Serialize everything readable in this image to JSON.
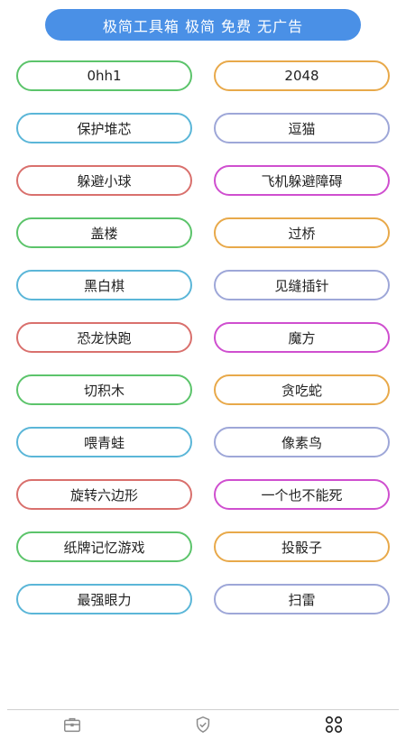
{
  "banner": {
    "text": "极简工具箱 极简 免费 无广告"
  },
  "games": [
    {
      "label": "0hh1",
      "color": "#5cc46b"
    },
    {
      "label": "2048",
      "color": "#e8a94a"
    },
    {
      "label": "保护堆芯",
      "color": "#5bb6d8"
    },
    {
      "label": "逗猫",
      "color": "#9ea7d8"
    },
    {
      "label": "躲避小球",
      "color": "#d9706d"
    },
    {
      "label": "飞机躲避障碍",
      "color": "#cf4fcf"
    },
    {
      "label": "盖楼",
      "color": "#5cc46b"
    },
    {
      "label": "过桥",
      "color": "#e8a94a"
    },
    {
      "label": "黑白棋",
      "color": "#5bb6d8"
    },
    {
      "label": "见缝插针",
      "color": "#9ea7d8"
    },
    {
      "label": "恐龙快跑",
      "color": "#d9706d"
    },
    {
      "label": "魔方",
      "color": "#cf4fcf"
    },
    {
      "label": "切积木",
      "color": "#5cc46b"
    },
    {
      "label": "贪吃蛇",
      "color": "#e8a94a"
    },
    {
      "label": "喂青蛙",
      "color": "#5bb6d8"
    },
    {
      "label": "像素鸟",
      "color": "#9ea7d8"
    },
    {
      "label": "旋转六边形",
      "color": "#d9706d"
    },
    {
      "label": "一个也不能死",
      "color": "#cf4fcf"
    },
    {
      "label": "纸牌记忆游戏",
      "color": "#5cc46b"
    },
    {
      "label": "投骰子",
      "color": "#e8a94a"
    },
    {
      "label": "最强眼力",
      "color": "#5bb6d8"
    },
    {
      "label": "扫雷",
      "color": "#9ea7d8"
    }
  ],
  "bottom_nav": [
    {
      "icon": "toolbox-icon",
      "color": "#8a8a8a"
    },
    {
      "icon": "shield-check-icon",
      "color": "#8a8a8a"
    },
    {
      "icon": "grid-apps-icon",
      "color": "#222222"
    }
  ]
}
